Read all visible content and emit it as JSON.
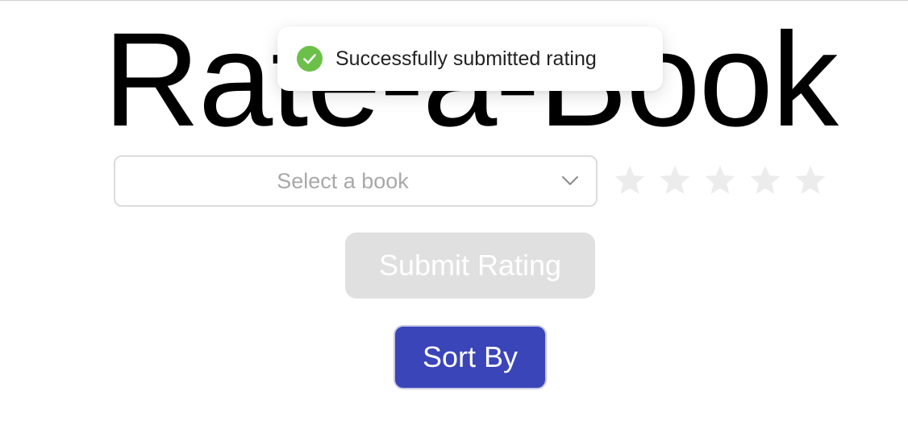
{
  "page": {
    "title": "Rate-a-Book"
  },
  "toast": {
    "message": "Successfully submitted rating",
    "icon": "check-circle-icon",
    "icon_color": "#6cc04a"
  },
  "book_select": {
    "placeholder": "Select a book",
    "icon": "chevron-down-icon"
  },
  "rating": {
    "max_stars": 5,
    "selected": 0,
    "icon": "star-icon",
    "inactive_color": "#ececec"
  },
  "actions": {
    "submit_label": "Submit Rating",
    "submit_color": "#e0e0e0",
    "sort_label": "Sort By",
    "sort_color": "#3945b8"
  }
}
